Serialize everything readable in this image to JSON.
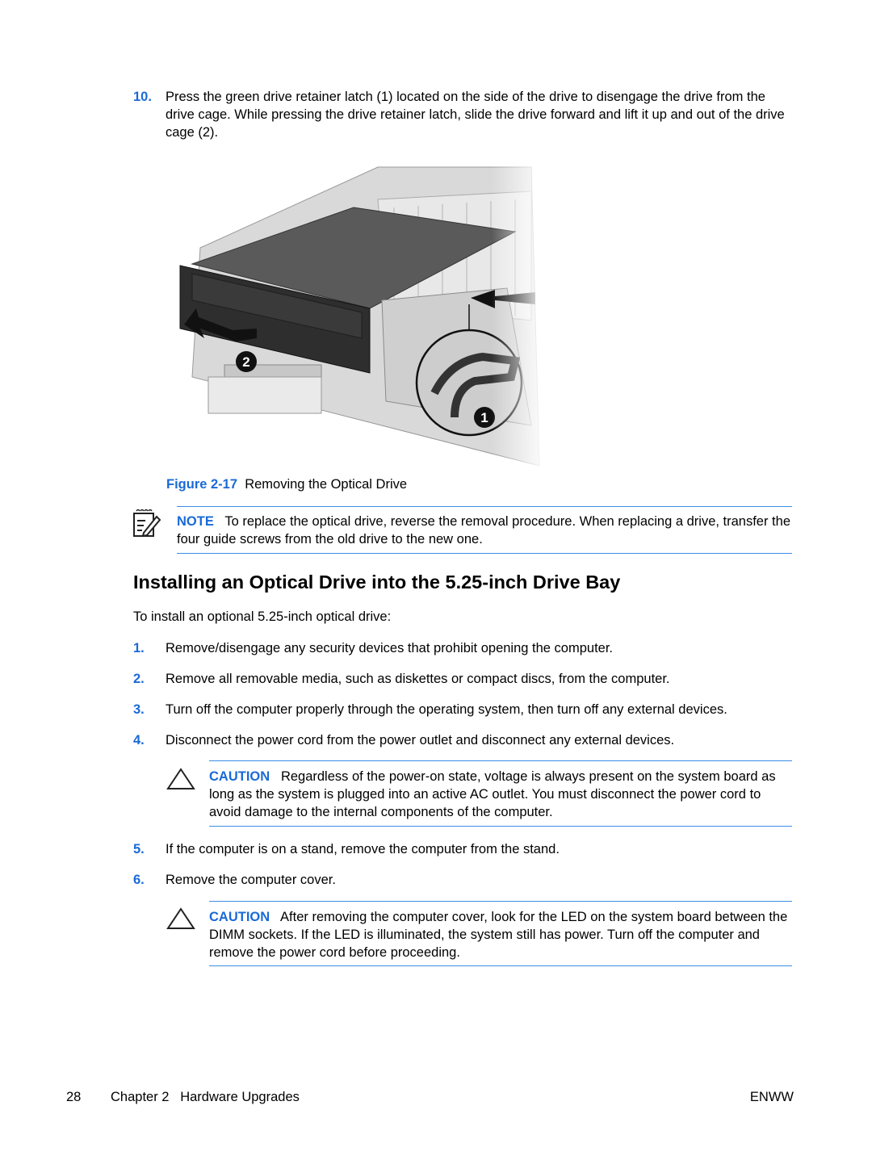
{
  "step10": {
    "number": "10.",
    "text": "Press the green drive retainer latch (1) located on the side of the drive to disengage the drive from the drive cage. While pressing the drive retainer latch, slide the drive forward and lift it up and out of the drive cage (2)."
  },
  "figure": {
    "callouts": [
      "2",
      "1"
    ],
    "label": "Figure 2-17",
    "caption": "Removing the Optical Drive"
  },
  "note": {
    "icon": "note-pencil-icon",
    "label": "NOTE",
    "text": "To replace the optical drive, reverse the removal procedure. When replacing a drive, transfer the four guide screws from the old drive to the new one."
  },
  "section": {
    "heading": "Installing an Optical Drive into the 5.25-inch Drive Bay",
    "intro": "To install an optional 5.25-inch optical drive:",
    "steps": [
      {
        "number": "1.",
        "text": "Remove/disengage any security devices that prohibit opening the computer."
      },
      {
        "number": "2.",
        "text": "Remove all removable media, such as diskettes or compact discs, from the computer."
      },
      {
        "number": "3.",
        "text": "Turn off the computer properly through the operating system, then turn off any external devices."
      },
      {
        "number": "4.",
        "text": "Disconnect the power cord from the power outlet and disconnect any external devices."
      },
      {
        "number": "5.",
        "text": "If the computer is on a stand, remove the computer from the stand."
      },
      {
        "number": "6.",
        "text": "Remove the computer cover."
      }
    ],
    "cautions": [
      {
        "icon": "caution-triangle-icon",
        "label": "CAUTION",
        "text": "Regardless of the power-on state, voltage is always present on the system board as long as the system is plugged into an active AC outlet. You must disconnect the power cord to avoid damage to the internal components of the computer."
      },
      {
        "icon": "caution-triangle-icon",
        "label": "CAUTION",
        "text": "After removing the computer cover, look for the LED on the system board between the DIMM sockets. If the LED is illuminated, the system still has power. Turn off the computer and remove the power cord before proceeding."
      }
    ]
  },
  "footer": {
    "page_number": "28",
    "chapter": "Chapter 2   Hardware Upgrades",
    "right_label": "ENWW"
  },
  "colors": {
    "accent": "#1a6ad6",
    "rule": "#3b8ee6"
  }
}
